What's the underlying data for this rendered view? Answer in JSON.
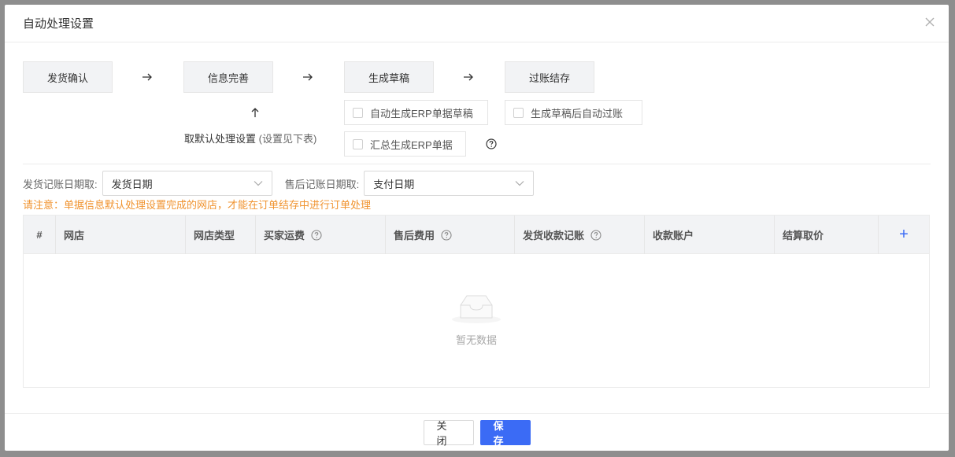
{
  "modal": {
    "title": "自动处理设置"
  },
  "flow": {
    "steps": [
      "发货确认",
      "信息完善",
      "生成草稿",
      "过账结存"
    ],
    "default_setting_label": "取默认处理设置",
    "default_setting_note": "(设置见下表)",
    "options": {
      "auto_draft": "自动生成ERP单据草稿",
      "summary_erp": "汇总生成ERP单据",
      "auto_post": "生成草稿后自动过账"
    }
  },
  "filters": {
    "ship_date_label": "发货记账日期取:",
    "ship_date_value": "发货日期",
    "aftersale_date_label": "售后记账日期取:",
    "aftersale_date_value": "支付日期"
  },
  "notice": "请注意：单据信息默认处理设置完成的网店，才能在订单结存中进行订单处理",
  "table": {
    "columns": [
      "#",
      "网店",
      "网店类型",
      "买家运费",
      "售后费用",
      "发货收款记账",
      "收款账户",
      "结算取价",
      "+"
    ],
    "empty_text": "暂无数据"
  },
  "footer": {
    "close_label": "关闭",
    "save_label": "保存"
  },
  "colors": {
    "primary": "#3b6bf5",
    "notice": "#f0932f"
  }
}
